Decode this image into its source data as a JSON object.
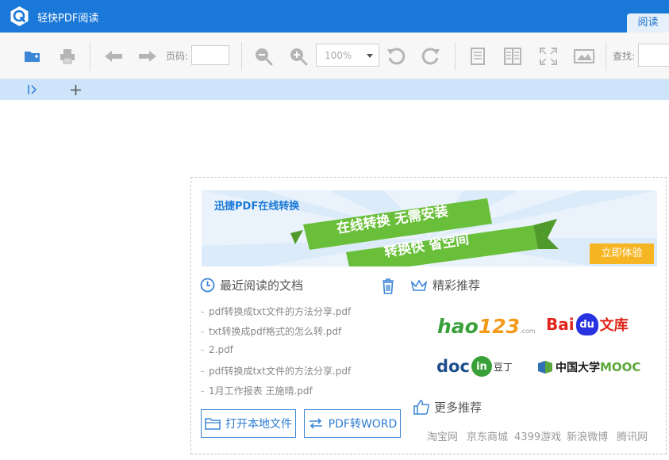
{
  "app": {
    "title": "轻快PDF阅读",
    "mode_tab": "阅读"
  },
  "toolbar": {
    "page_label": "页码:",
    "page_value": "",
    "zoom_value": "100%",
    "search_label": "查找:",
    "search_value": ""
  },
  "banner": {
    "title": "迅捷PDF在线转换",
    "line1": "在线转换 无需安装",
    "line2": "转换快 省空间",
    "cta": "立即体验"
  },
  "recent": {
    "heading": "最近阅读的文档",
    "items": [
      "pdf转换成txt文件的方法分享.pdf",
      "txt转换成pdf格式的怎么转.pdf",
      "2.pdf",
      "pdf转换成txt文件的方法分享.pdf",
      "1月工作报表 王施晴.pdf"
    ],
    "open_local": "打开本地文件",
    "pdf_to_word": "PDF转WORD"
  },
  "featured": {
    "heading": "精彩推荐",
    "partners": {
      "hao123": {
        "main": "hao",
        "num": "123",
        "suffix": ".com"
      },
      "baidu": {
        "main_a": "Bai",
        "paw": "du",
        "main_b": "文库"
      },
      "docin": {
        "main": "doc",
        "circle": "in",
        "suffix": "豆丁"
      },
      "mooc": {
        "main": "中国大学",
        "suffix": "MOOC"
      }
    }
  },
  "more": {
    "heading": "更多推荐",
    "links": [
      "淘宝网",
      "京东商城",
      "4399游戏",
      "新浪微博",
      "腾讯网"
    ]
  },
  "colors": {
    "titlebar": "#1a78d8",
    "tabstrip": "#cde4fa",
    "accent_blue": "#2a7bd0",
    "banner_green": "#6abf3a",
    "cta_orange": "#f6b624"
  }
}
